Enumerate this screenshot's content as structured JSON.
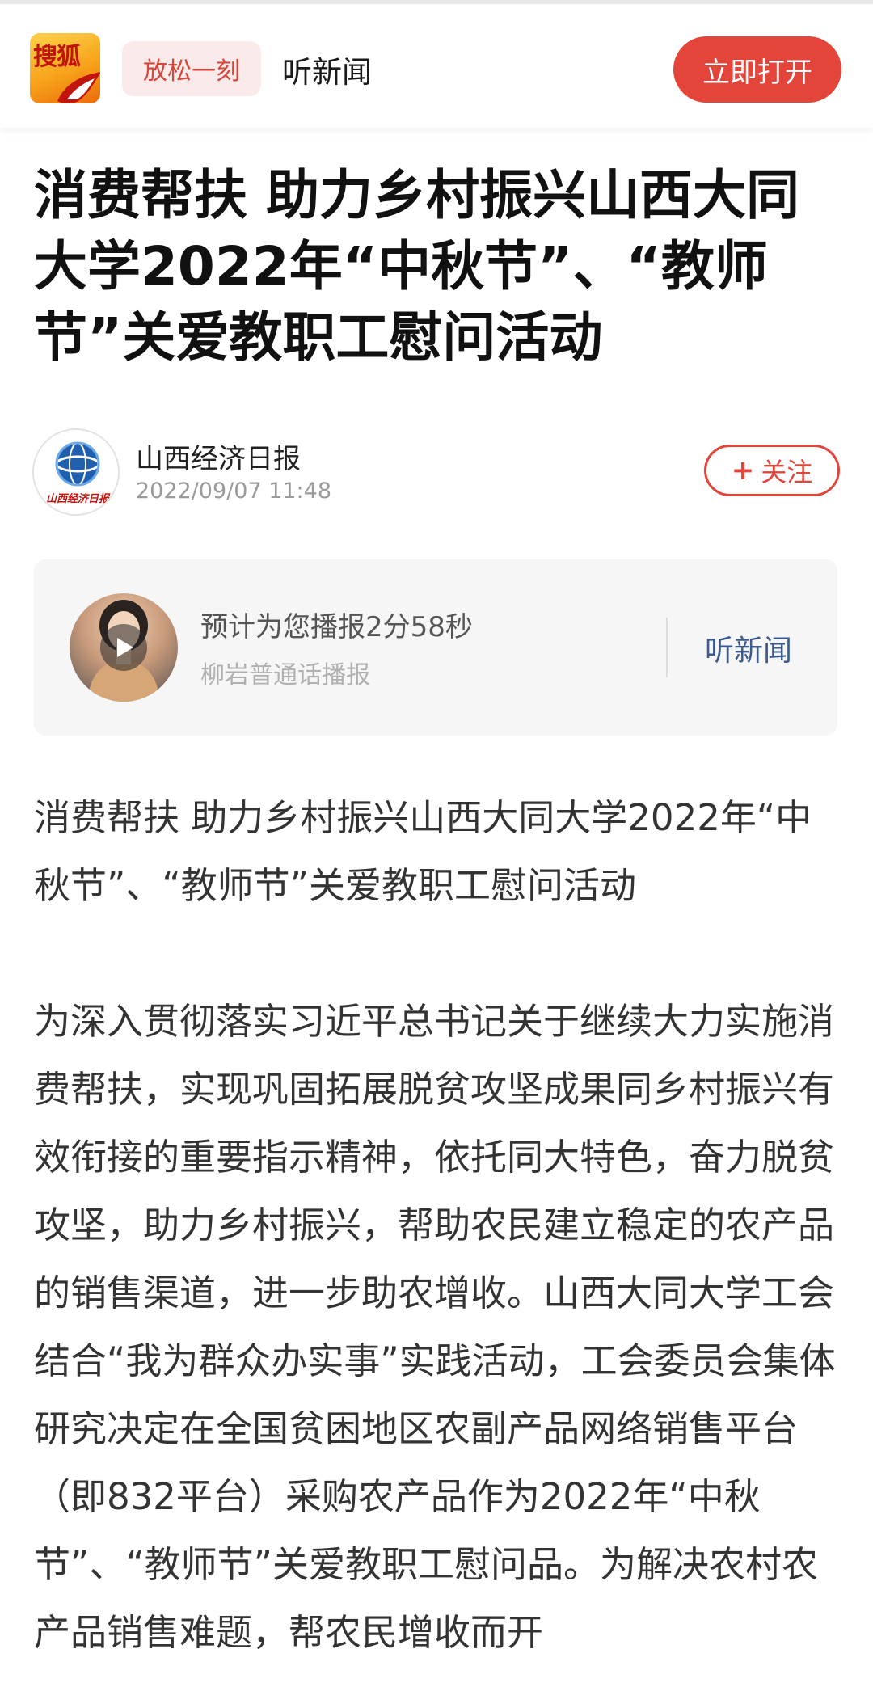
{
  "topbar": {
    "logo_text": "搜狐",
    "relax_label": "放松一刻",
    "listen_label": "听新闻",
    "open_button": "立即打开"
  },
  "article": {
    "title": "消费帮扶 助力乡村振兴山西大同大学2022年“中秋节”、“教师节”关爱教职工慰问活动",
    "author": {
      "name": "山西经济日报",
      "time": "2022/09/07 11:48",
      "logo_text": "山西经济日报"
    },
    "follow": {
      "plus": "+",
      "label": "关注"
    },
    "audio": {
      "estimate": "预计为您播报2分58秒",
      "voice": "柳岩普通话播报",
      "listen_label": "听新闻"
    },
    "lead": "消费帮扶 助力乡村振兴山西大同大学2022年“中秋节”、“教师节”关爱教职工慰问活动",
    "paragraph": "为深入贯彻落实习近平总书记关于继续大力实施消费帮扶，实现巩固拓展脱贫攻坚成果同乡村振兴有效衔接的重要指示精神，依托同大特色，奋力脱贫攻坚，助力乡村振兴，帮助农民建立稳定的农产品的销售渠道，进一步助农增收。山西大同大学工会结合“我为群众办实事”实践活动，工会委员会集体研究决定在全国贫困地区农副产品网络销售平台（即832平台）采购农产品作为2022年“中秋节”、“教师节”关爱教职工慰问品。为解决农村农产品销售难题，帮农民增收而开"
  }
}
